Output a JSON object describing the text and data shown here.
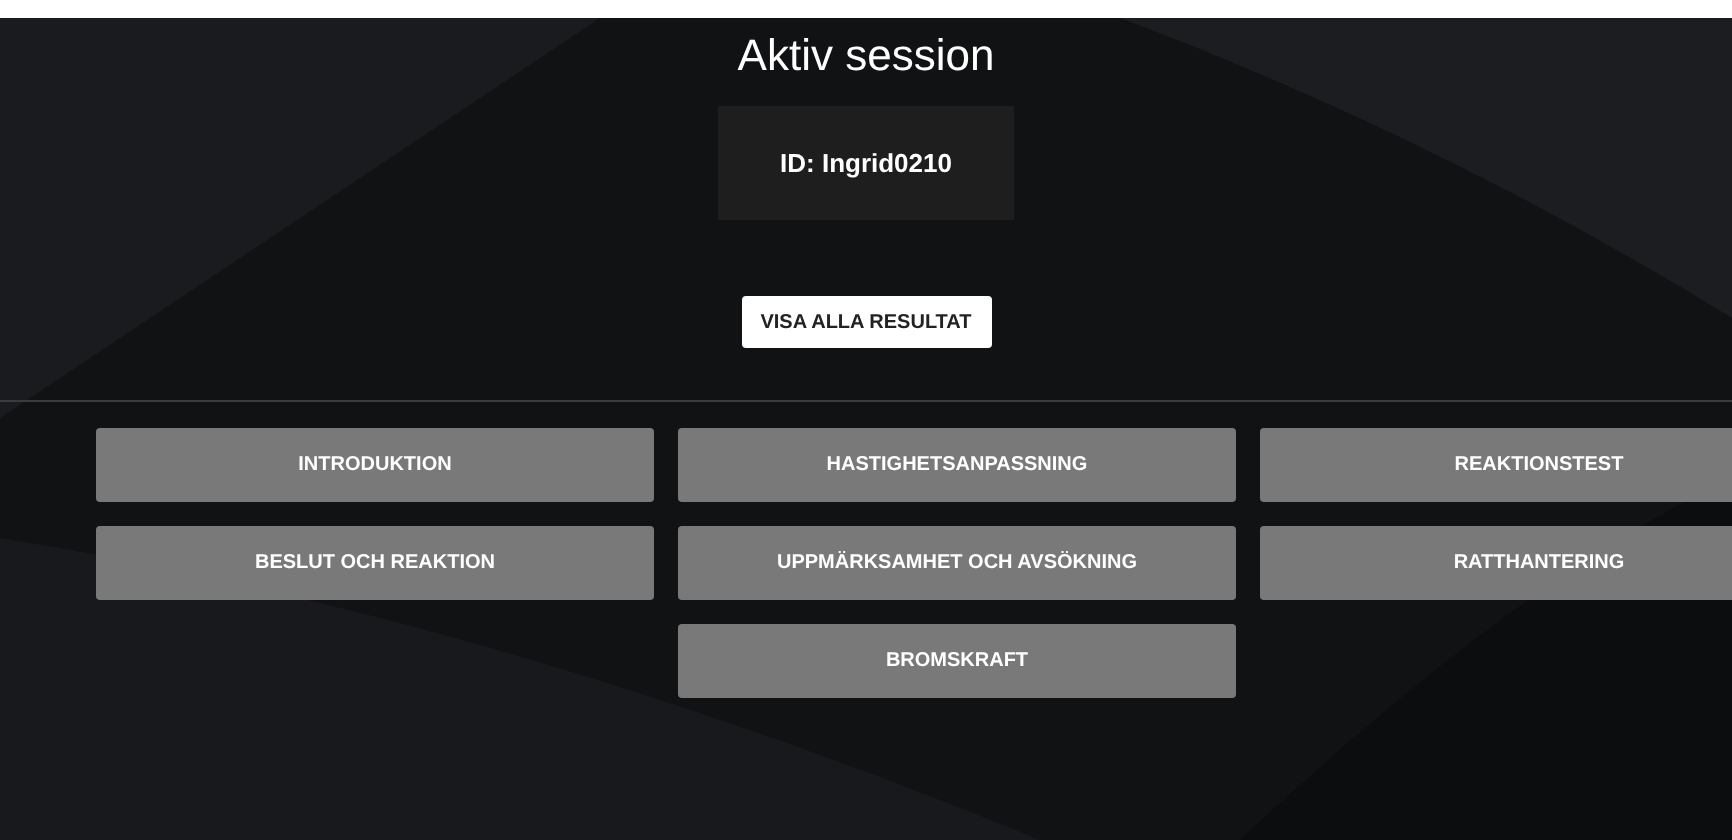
{
  "title": "Aktiv session",
  "session_id": "ID: Ingrid0210",
  "show_results_button": "VISA ALLA RESULTAT",
  "modules": [
    {
      "label": "INTRODUKTION"
    },
    {
      "label": "HASTIGHETSANPASSNING"
    },
    {
      "label": "REAKTIONSTEST"
    },
    {
      "label": "BESLUT OCH REAKTION"
    },
    {
      "label": "UPPMÄRKSAMHET OCH AVSÖKNING"
    },
    {
      "label": "RATTHANTERING"
    },
    {
      "label": "BROMSKRAFT"
    }
  ]
}
